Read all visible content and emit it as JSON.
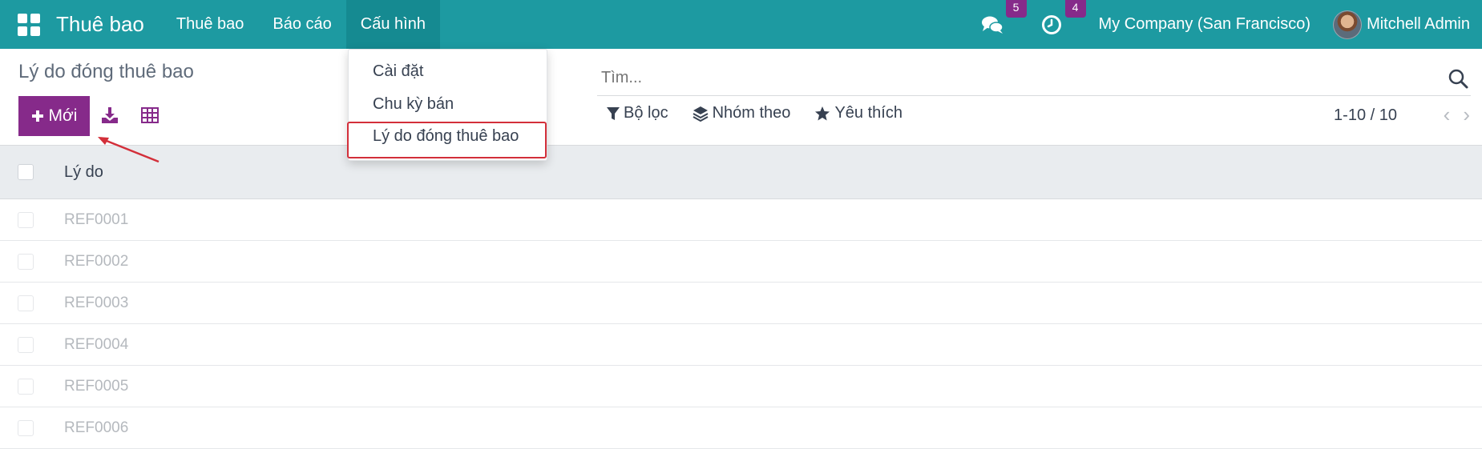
{
  "navbar": {
    "app_title": "Thuê bao",
    "menu": [
      "Thuê bao",
      "Báo cáo",
      "Cấu hình"
    ],
    "chat_badge": "5",
    "activity_badge": "4",
    "company": "My Company (San Francisco)",
    "user": "Mitchell Admin"
  },
  "page": {
    "title": "Lý do đóng thuê bao",
    "new_button": "Mới"
  },
  "search": {
    "placeholder": "Tìm..."
  },
  "filters": {
    "filter": "Bộ lọc",
    "group_by": "Nhóm theo",
    "favorites": "Yêu thích"
  },
  "pager": {
    "text": "1-10 / 10"
  },
  "table": {
    "header": "Lý do",
    "rows": [
      "REF0001",
      "REF0002",
      "REF0003",
      "REF0004",
      "REF0005",
      "REF0006"
    ]
  },
  "dropdown": {
    "items": [
      "Cài đặt",
      "Chu kỳ bán",
      "Lý do đóng thuê bao"
    ]
  },
  "colors": {
    "navbar": "#1d9aa1",
    "primary": "#862a8a",
    "highlight": "#d32f3a"
  }
}
